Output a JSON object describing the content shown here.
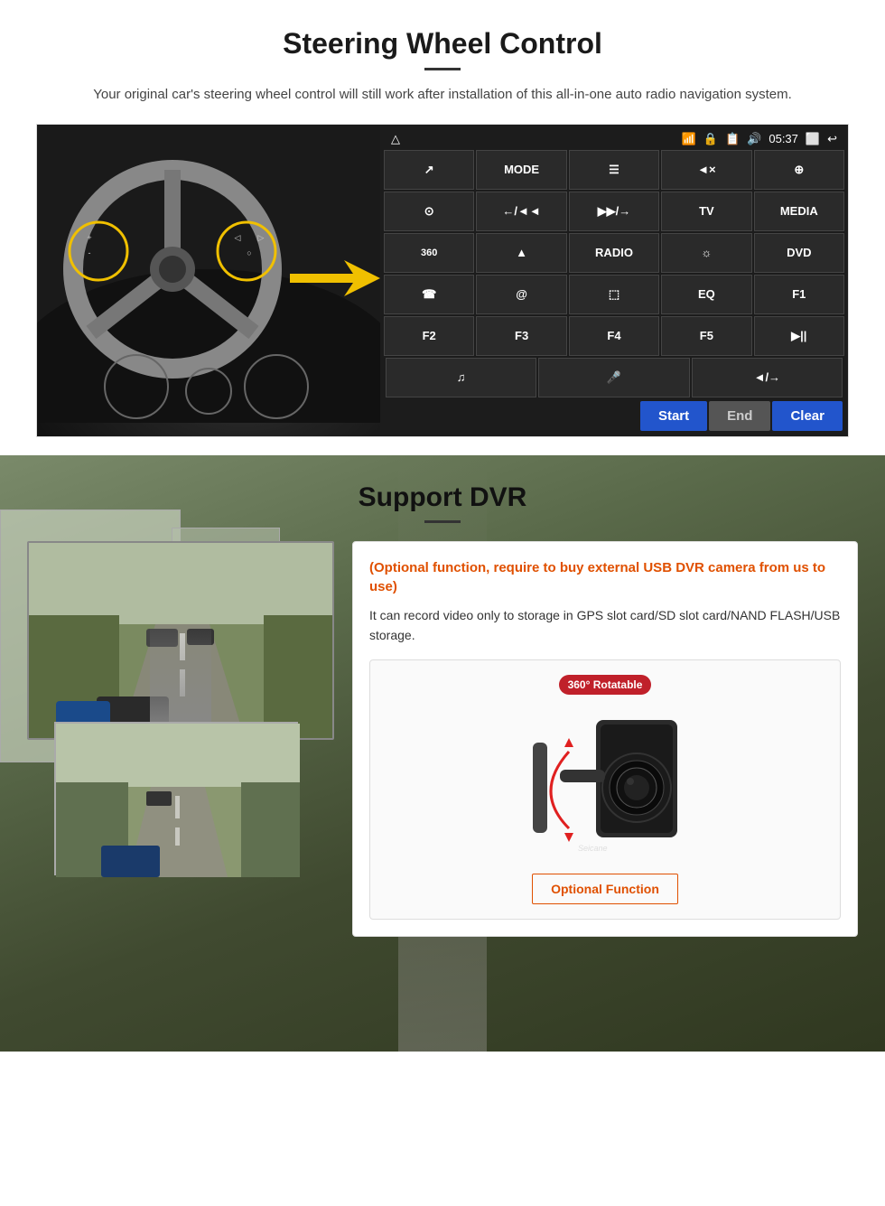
{
  "steering": {
    "title": "Steering Wheel Control",
    "description": "Your original car's steering wheel control will still work after installation of this all-in-one auto radio navigation system.",
    "panel": {
      "time": "05:37",
      "rows": [
        [
          "↗",
          "MODE",
          "≡",
          "◄×",
          "⊕"
        ],
        [
          "⊙",
          "←/◄◄",
          "▶▶/→",
          "TV",
          "MEDIA"
        ],
        [
          "360",
          "▲",
          "RADIO",
          "☼",
          "DVD"
        ],
        [
          "☎",
          "@",
          "⬚",
          "EQ",
          "F1"
        ],
        [
          "F2",
          "F3",
          "F4",
          "F5",
          "▶||"
        ],
        [
          "♫",
          "🎤",
          "◄/→"
        ]
      ],
      "actions": {
        "start": "Start",
        "end": "End",
        "clear": "Clear"
      }
    }
  },
  "dvr": {
    "title": "Support DVR",
    "optional_text": "(Optional function, require to buy external USB DVR camera from us to use)",
    "description": "It can record video only to storage in GPS slot card/SD slot card/NAND FLASH/USB storage.",
    "camera": {
      "badge": "360° Rotatable",
      "watermark": "Seicane"
    },
    "optional_fn": "Optional Function"
  }
}
